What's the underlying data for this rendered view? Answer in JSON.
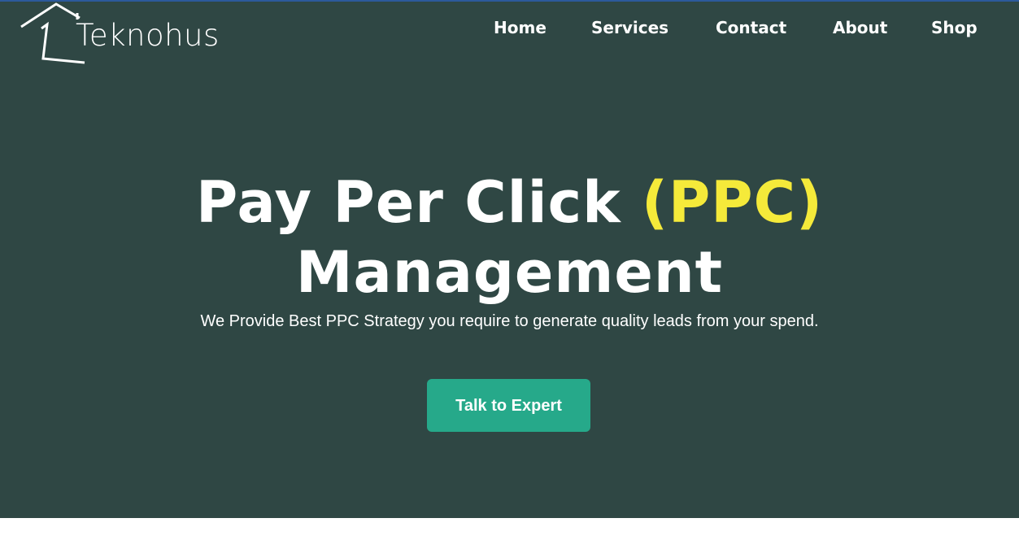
{
  "brand": {
    "name": "Teknohus"
  },
  "nav": {
    "items": [
      {
        "label": "Home"
      },
      {
        "label": "Services"
      },
      {
        "label": "Contact"
      },
      {
        "label": "About"
      },
      {
        "label": "Shop"
      }
    ]
  },
  "hero": {
    "title_part1": "Pay Per Click ",
    "title_highlight": "(PPC)",
    "title_line2": "Management",
    "subtitle": "We Provide Best PPC Strategy you require to generate quality leads from your spend.",
    "cta_label": "Talk to Expert"
  },
  "colors": {
    "hero_bg": "#2f4744",
    "highlight": "#f5ea3a",
    "cta_bg": "#26a98a",
    "text": "#ffffff"
  }
}
